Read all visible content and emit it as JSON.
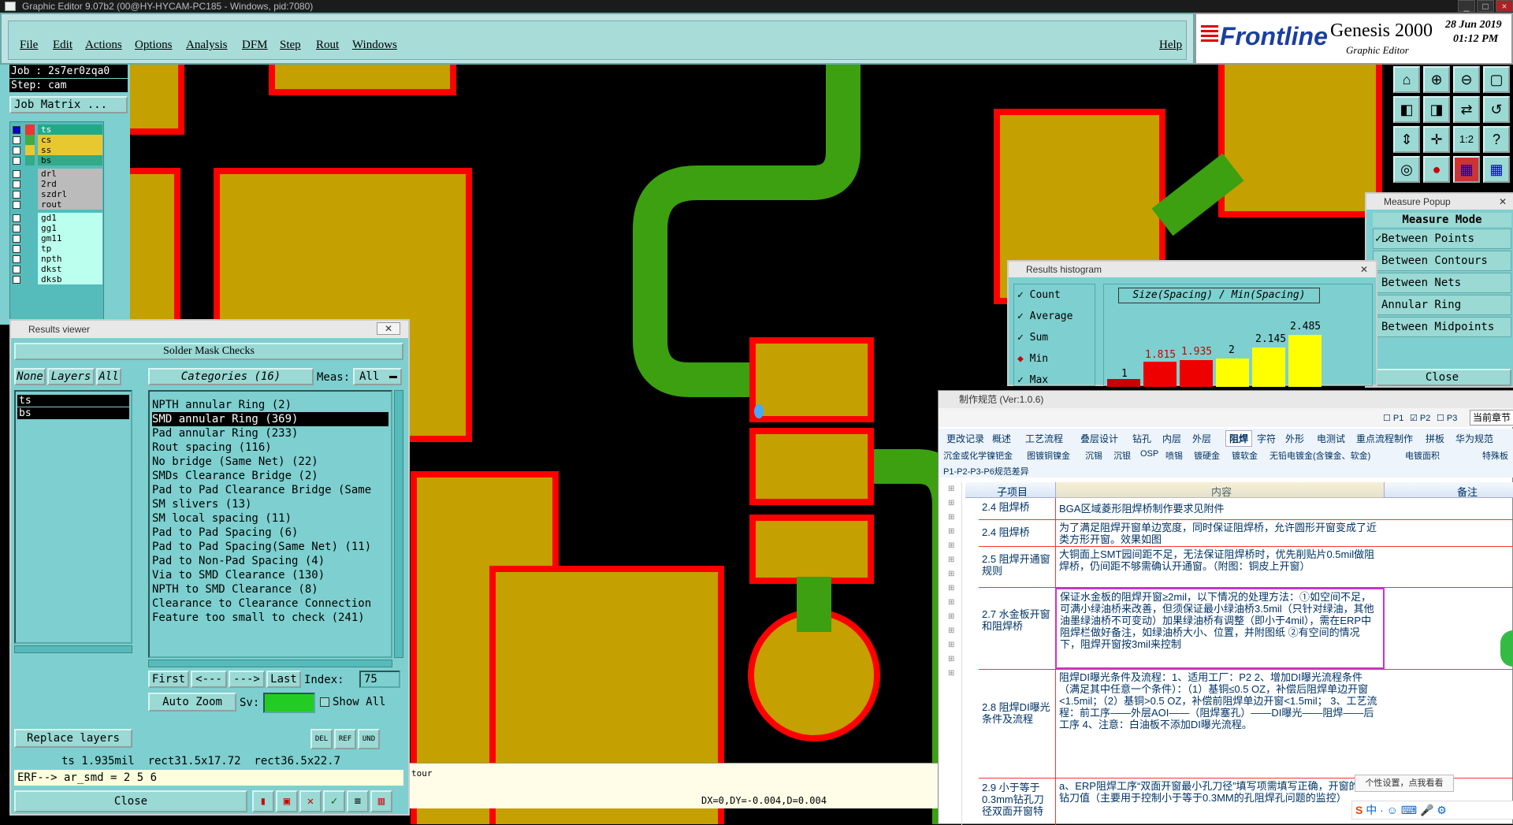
{
  "window": {
    "title": "Graphic Editor 9.07b2 (00@HY-HYCAM-PC185 - Windows, pid:7080)"
  },
  "menu": {
    "items": [
      "File",
      "Edit",
      "Actions",
      "Options",
      "Analysis",
      "DFM",
      "Step",
      "Rout",
      "Windows"
    ],
    "help": "Help"
  },
  "brand": {
    "logo": "Frontline",
    "product": "Genesis 2000",
    "subtitle": "Graphic Editor",
    "date": "28 Jun 2019",
    "time": "01:12 PM"
  },
  "job": {
    "job_label": "Job : 2s7er0zqa0",
    "step_label": "Step: cam",
    "matrix_button": "Job Matrix ..."
  },
  "layers": [
    {
      "name": "ts",
      "color": "#e33"
    },
    {
      "name": "cs",
      "color": "#4a4"
    },
    {
      "name": "ss",
      "color": "#e8c830"
    },
    {
      "name": "bs",
      "color": "#3a8"
    },
    {
      "name": "drl",
      "color": "#7ecfcf"
    },
    {
      "name": "2rd",
      "color": "#7ecfcf"
    },
    {
      "name": "szdrl",
      "color": "#7ecfcf"
    },
    {
      "name": "rout",
      "color": "#7ecfcf"
    },
    {
      "name": "gd1",
      "color": "#7ecfcf"
    },
    {
      "name": "gg1",
      "color": "#7ecfcf"
    },
    {
      "name": "gm11",
      "color": "#7ecfcf"
    },
    {
      "name": "tp",
      "color": "#7ecfcf"
    },
    {
      "name": "npth",
      "color": "#7ecfcf"
    },
    {
      "name": "dkst",
      "color": "#7ecfcf"
    },
    {
      "name": "dksb",
      "color": "#7ecfcf"
    }
  ],
  "results_viewer": {
    "title": "Results viewer",
    "heading": "Solder Mask Checks",
    "none_btn": "None",
    "layers_btn": "Layers",
    "all_btn": "All",
    "categories_btn": "Categories (16)",
    "meas_label": "Meas:",
    "meas_value": "All",
    "layer_list": [
      "ts",
      "bs"
    ],
    "categories": [
      "NPTH annular Ring (2)",
      "SMD annular Ring (369)",
      "Pad annular Ring (233)",
      "Rout spacing (116)",
      "No bridge (Same Net) (22)",
      "SMDs Clearance Bridge (2)",
      "Pad to Pad Clearance Bridge (Same",
      "SM slivers (13)",
      "SM local spacing (11)",
      "Pad to Pad Spacing (6)",
      "Pad to Pad Spacing(Same Net) (11)",
      "Pad to Non-Pad Spacing (4)",
      "Via to SMD Clearance (130)",
      "NPTH to SMD Clearance (8)",
      "Clearance to Clearance Connection",
      "Feature too small to check (241)"
    ],
    "selected_category": 1,
    "first_btn": "First",
    "prev_btn": "<---",
    "next_btn": "--->",
    "last_btn": "Last",
    "index_label": "Index:",
    "index_value": "75",
    "zoom_btn": "Auto Zoom",
    "sv_label": "Sv:",
    "show_all": "Show All",
    "replace_btn": "Replace layers",
    "status_line": "ts 1.935mil  rect31.5x17.72  rect36.5x22.7",
    "erf_line": "ERF--> ar_smd = 2 5 6",
    "close_btn": "Close"
  },
  "histogram": {
    "title": "Results histogram",
    "modes": [
      "Count",
      "Average",
      "Sum",
      "Min",
      "Max"
    ],
    "selected_mode": "Min",
    "chart_title": "Size(Spacing) / Min(Spacing)",
    "bar_labels": [
      "1",
      "1.815",
      "1.935",
      "2",
      "2.145",
      "2.485"
    ]
  },
  "measure": {
    "title": "Measure Popup",
    "mode_header": "Measure Mode",
    "items": [
      "Between Points",
      "Between Contours",
      "Between Nets",
      "Annular Ring",
      "Between Midpoints"
    ],
    "close_btn": "Close"
  },
  "canvas": {
    "readout": "DX=0,DY=-0.004,D=0.004",
    "left_text": "tour"
  },
  "spec": {
    "title": "制作规范 (Ver:1.0.6)",
    "page_tabs": [
      "P1",
      "P2",
      "P3"
    ],
    "current_section": "当前章节",
    "tabs_row1": [
      "更改记录",
      "概述",
      "工艺流程",
      "叠层设计",
      "钻孔",
      "内层",
      "外层",
      "阻焊",
      "字符",
      "外形",
      "电测试",
      "重点流程制作",
      "拼板",
      "华为规范"
    ],
    "tabs_row2": [
      "沉金或化学镍钯金",
      "图镀铜镍金",
      "沉锡",
      "沉银",
      "OSP",
      "喷锡",
      "镀硬金",
      "镀软金",
      "无铅电镀金(含镍金、软金)",
      "电镀面积",
      "特殊板"
    ],
    "tabs_row3": [
      "P1-P2-P3-P6规范差异"
    ],
    "col_headers": [
      "子项目",
      "内容",
      "备注"
    ],
    "rows": [
      {
        "sub": "2.4 阻焊桥",
        "content": "BGA区域菱形阻焊桥制作要求见附件"
      },
      {
        "sub": "2.4 阻焊桥",
        "content": "为了满足阻焊开窗单边宽度，同时保证阻焊桥，允许圆形开窗变成了近类方形开窗。效果如图"
      },
      {
        "sub": "2.5 阻焊开通窗规则",
        "content": "大铜面上SMT园间距不足，无法保证阻焊桥时，优先削贴片0.5mil做阻焊桥，仍间距不够需确认开通窗。（附图：铜皮上开窗）"
      },
      {
        "sub": "2.7 水金板开窗和阻焊桥",
        "content": "保证水金板的阻焊开窗≥2mil，以下情况的处理方法：①如空间不足，可满小绿油桥来改善，但须保证最小绿油桥3.5mil（只针对绿油，其他油墨绿油桥不可变动）加果绿油桥有调整（即小于4mil），需在ERP中阻焊栏做好备注，如绿油桥大小、位置，并附图纸 ②有空间的情况下，阻焊开窗按3mil来控制"
      },
      {
        "sub": "2.8 阻焊DI曝光条件及流程",
        "content": "阻焊DI曝光条件及流程：1、适用工厂：P2 2、增加DI曝光流程条件（满足其中任意一个条件）：（1）基铜≤0.5 OZ，补偿后阻焊单边开窗<1.5mil；（2）基铜>0.5 OZ，补偿前阻焊单边开窗<1.5mil； 3、工艺流程：前工序——外层AOI——（阻焊塞孔）——DI曝光——阻焊——后工序 4、注意：白油板不添加DI曝光流程。"
      },
      {
        "sub": "2.9 小于等于0.3mm钻孔刀径双面开窗特",
        "content": "a、ERP阻焊工序“双面开窗最小孔刀径”填写项需填写正确，开窗的最小钻刀值（主要用于控制小于等于0.3MM的孔阻焊孔问题的监控）"
      }
    ],
    "tooltip": "个性设置，点我看看"
  },
  "colors": {
    "copper": "#c4a000",
    "mask": "#ff0000",
    "trace": "#3ca010",
    "background": "#000000",
    "panel": "#7ecfcf"
  }
}
